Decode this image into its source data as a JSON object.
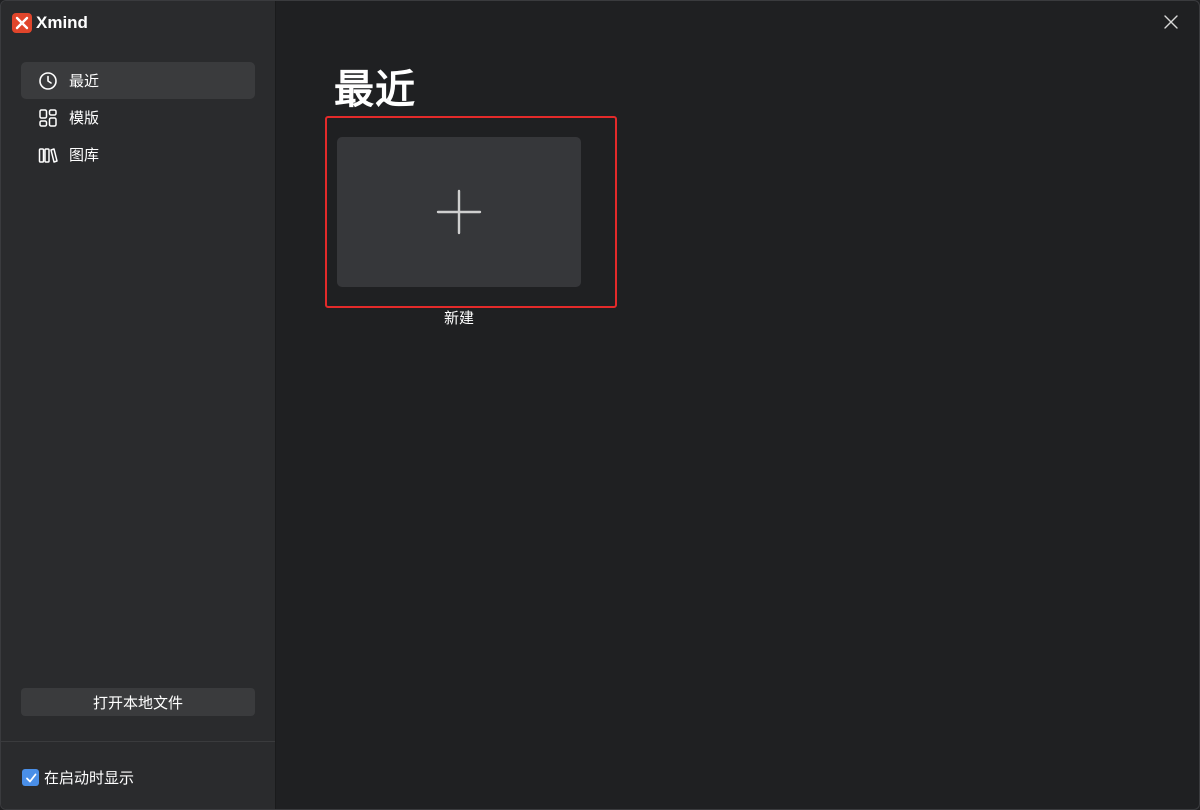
{
  "app": {
    "name": "Xmind",
    "logo_icon": "xmind-logo-icon",
    "brand_color": "#e0452b"
  },
  "sidebar": {
    "items": [
      {
        "label": "最近",
        "icon": "clock-icon",
        "active": true
      },
      {
        "label": "模版",
        "icon": "grid-icon",
        "active": false
      },
      {
        "label": "图库",
        "icon": "library-icon",
        "active": false
      }
    ],
    "open_file_label": "打开本地文件",
    "startup_checkbox": {
      "label": "在启动时显示",
      "checked": true
    }
  },
  "main": {
    "title": "最近",
    "new_card": {
      "label": "新建",
      "icon": "plus-icon"
    }
  },
  "window": {
    "close_icon": "close-icon"
  },
  "colors": {
    "highlight": "#e32a2a",
    "checkbox": "#4a8fe8",
    "sidebar_bg": "#2a2b2d",
    "main_bg": "#1f2022",
    "card_bg": "#36373a"
  }
}
